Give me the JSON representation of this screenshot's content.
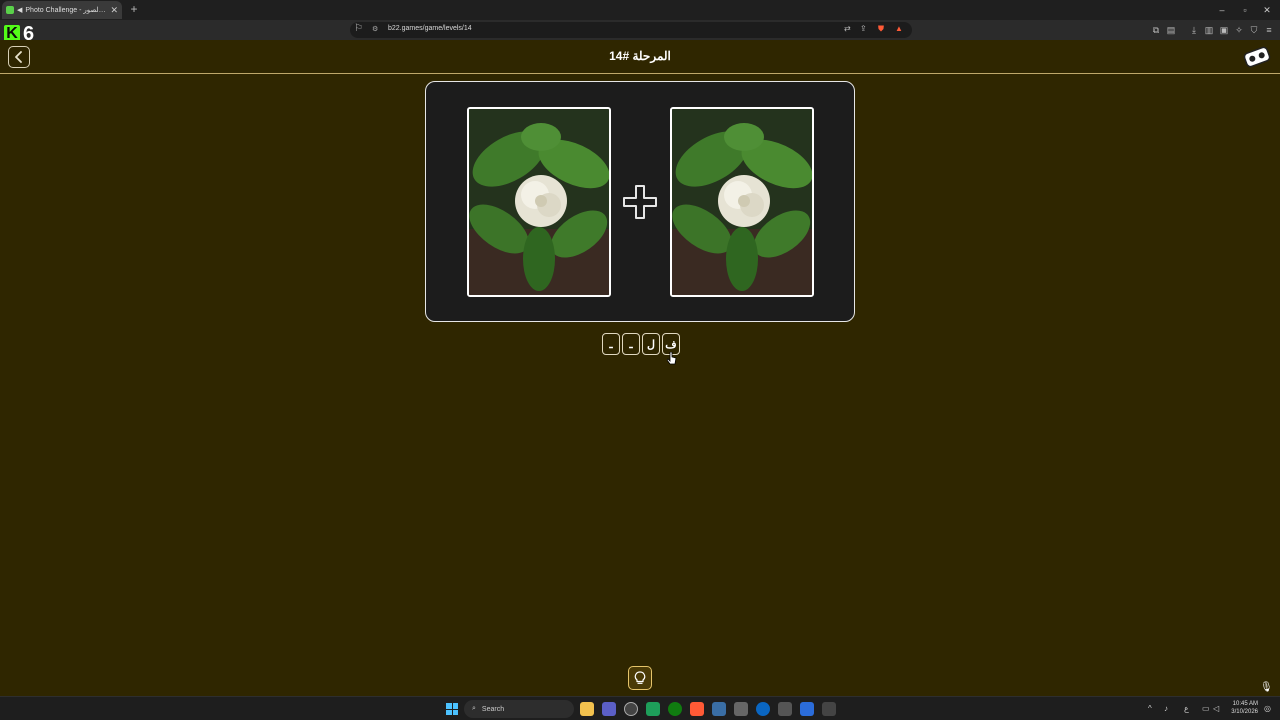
{
  "browser": {
    "tab_title": "Photo Challenge - تحدي الصور",
    "url": "b22.games/game/levels/14",
    "new_tab_label": "+",
    "close_tab_label": "✕"
  },
  "stream": {
    "platform_badge": "K",
    "number": "6"
  },
  "header": {
    "title": "المرحلة #14",
    "back_icon": "chevron-left-icon"
  },
  "puzzle": {
    "images": [
      "gardenia-flower-photo",
      "gardenia-flower-photo"
    ],
    "operator_icon": "plus-icon",
    "answer_slots": [
      "ف",
      "ل",
      "ـ",
      "ـ"
    ]
  },
  "hint": {
    "icon": "lightbulb-icon"
  },
  "taskbar": {
    "search_label": "Search",
    "time": "10:45 AM",
    "date": "3/10/2026",
    "lang": "ع"
  },
  "colors": {
    "page_bg": "#2f2600",
    "card_bg": "#1c1c1c",
    "accent": "#e6c46a"
  }
}
